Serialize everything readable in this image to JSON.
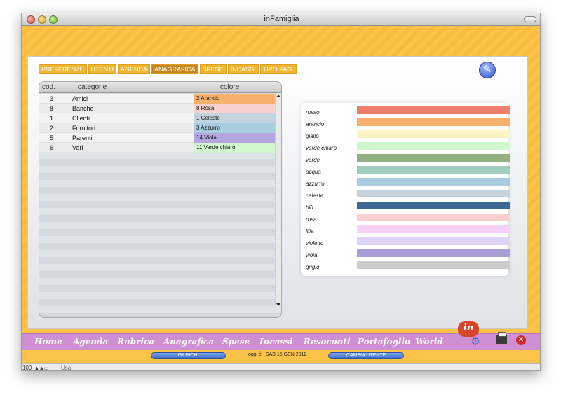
{
  "window": {
    "title": "inFamiglia"
  },
  "tabs": [
    {
      "label": "PREFERENZE",
      "active": false
    },
    {
      "label": "UTENTI",
      "active": false
    },
    {
      "label": "AGENDA",
      "active": false
    },
    {
      "label": "ANAGRAFICA",
      "active": true
    },
    {
      "label": "SPESE",
      "active": false
    },
    {
      "label": "INCASSI",
      "active": false
    },
    {
      "label": "TIPO PAG.",
      "active": false
    }
  ],
  "table": {
    "headers": {
      "cod": "cod.",
      "categorie": "categorie",
      "colore": "colore"
    },
    "rows": [
      {
        "cod": "3",
        "categoria": "Amici",
        "colore": "2 Arancio",
        "color_hex": "#f7b16d"
      },
      {
        "cod": "8",
        "categoria": "Banche",
        "colore": "8 Rosa",
        "color_hex": "#f8d1cf"
      },
      {
        "cod": "1",
        "categoria": "Clienti",
        "colore": "1 Celeste",
        "color_hex": "#c3d3df"
      },
      {
        "cod": "2",
        "categoria": "Fornitori",
        "colore": "3 Azzurro",
        "color_hex": "#a9cde0"
      },
      {
        "cod": "5",
        "categoria": "Parenti",
        "colore": "14 Viola",
        "color_hex": "#b5a6e2"
      },
      {
        "cod": "6",
        "categoria": "Vari",
        "colore": "11 Verde chiaro",
        "color_hex": "#d0f7cd"
      }
    ]
  },
  "legend": [
    {
      "name": "rosso",
      "color": "#ef7d6c"
    },
    {
      "name": "arancio",
      "color": "#f8b16d"
    },
    {
      "name": "giallo",
      "color": "#fdf5c2"
    },
    {
      "name": "verde chiaro",
      "color": "#d0f7cd"
    },
    {
      "name": "verde",
      "color": "#93b07e"
    },
    {
      "name": "acqua",
      "color": "#9fcdbe"
    },
    {
      "name": "azzurro",
      "color": "#a9cde0"
    },
    {
      "name": "celeste",
      "color": "#c3d3df"
    },
    {
      "name": "blù",
      "color": "#3d6893"
    },
    {
      "name": "rosa",
      "color": "#f8d1cf"
    },
    {
      "name": "lilla",
      "color": "#f7d1f6"
    },
    {
      "name": "violetto",
      "color": "#ddd3f6"
    },
    {
      "name": "viola",
      "color": "#ab9fd8"
    },
    {
      "name": "grigio",
      "color": "#cccccc"
    }
  ],
  "nav": [
    "Home",
    "Agenda",
    "Rubrica",
    "Anagrafica",
    "Spese",
    "Incassi",
    "Resoconti",
    "Portafoglio",
    "World"
  ],
  "logo_text": "in",
  "footer": {
    "user_button": "GIUNCHI",
    "date_label": "oggi è",
    "date_value": "SAB 15 GEN 2011",
    "change_user_button": "CAMBIA UTENTE"
  },
  "statusbar": {
    "zoom": "100",
    "mode": "Usa"
  }
}
